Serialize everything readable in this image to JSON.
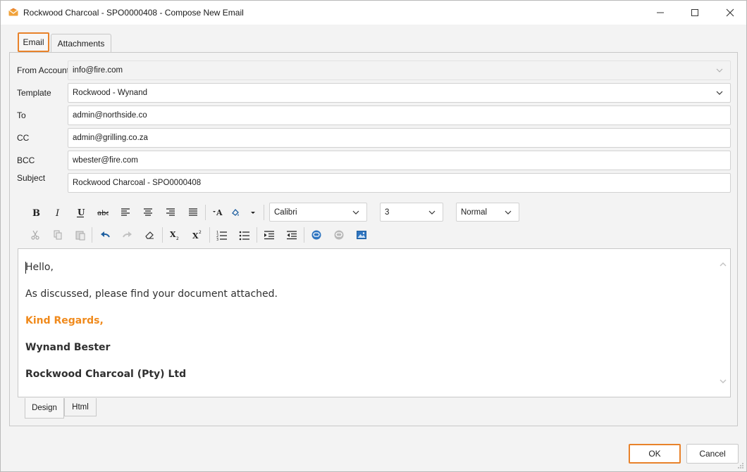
{
  "window": {
    "title": "Rockwood Charcoal - SPO0000408 - Compose New Email",
    "accent": "#e8822a"
  },
  "tabs": [
    {
      "label": "Email",
      "active": true
    },
    {
      "label": "Attachments",
      "active": false
    }
  ],
  "form": {
    "from_label": "From Account",
    "from_value": "info@fire.com",
    "template_label": "Template",
    "template_value": "Rockwood - Wynand",
    "to_label": "To",
    "to_value": "admin@northside.co",
    "cc_label": "CC",
    "cc_value": "admin@grilling.co.za",
    "bcc_label": "BCC",
    "bcc_value": "wbester@fire.com",
    "subject_label": "Subject",
    "subject_value": "Rockwood Charcoal - SPO0000408"
  },
  "toolbar": {
    "font": "Calibri",
    "size": "3",
    "style": "Normal"
  },
  "editor": {
    "line1": "Hello,",
    "line2": "As discussed, please find your document attached.",
    "line3": "Kind Regards,",
    "line4": "Wynand Bester",
    "line5": "Rockwood Charcoal (Pty) Ltd",
    "regards_color": "#f08a1c"
  },
  "view_tabs": [
    {
      "label": "Design",
      "active": true
    },
    {
      "label": "Html",
      "active": false
    }
  ],
  "footer": {
    "ok_label": "OK",
    "cancel_label": "Cancel"
  }
}
